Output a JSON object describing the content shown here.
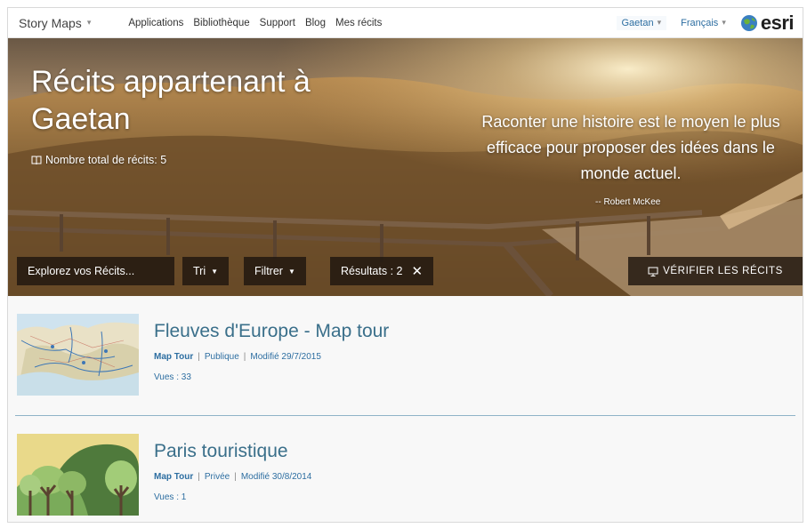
{
  "nav": {
    "brand": "Story Maps",
    "links": [
      "Applications",
      "Bibliothèque",
      "Support",
      "Blog",
      "Mes récits"
    ],
    "user": "Gaetan",
    "language": "Français",
    "logo_text": "esri"
  },
  "hero": {
    "title": "Récits appartenant à Gaetan",
    "count_label": "Nombre total de récits: 5",
    "quote": "Raconter une histoire est le moyen le plus efficace pour proposer des idées dans le monde actuel.",
    "quote_author": "-- Robert McKee"
  },
  "filters": {
    "search": "Explorez vos Récits...",
    "sort": "Tri",
    "filter": "Filtrer",
    "results": "Résultats : 2",
    "verify": "VÉRIFIER LES RÉCITS"
  },
  "stories": [
    {
      "title": "Fleuves d'Europe - Map tour",
      "type": "Map Tour",
      "visibility": "Publique",
      "modified": "Modifié 29/7/2015",
      "views": "Vues : 33",
      "thumb_icon": "europe-map-thumbnail"
    },
    {
      "title": "Paris touristique",
      "type": "Map Tour",
      "visibility": "Privée",
      "modified": "Modifié 30/8/2014",
      "views": "Vues : 1",
      "thumb_icon": "trees-illustration-thumbnail"
    }
  ],
  "colors": {
    "link": "#2d6ea1",
    "title": "#3a6f8a",
    "divider": "#8fb3c7",
    "filter_bg": "#1e160f"
  }
}
